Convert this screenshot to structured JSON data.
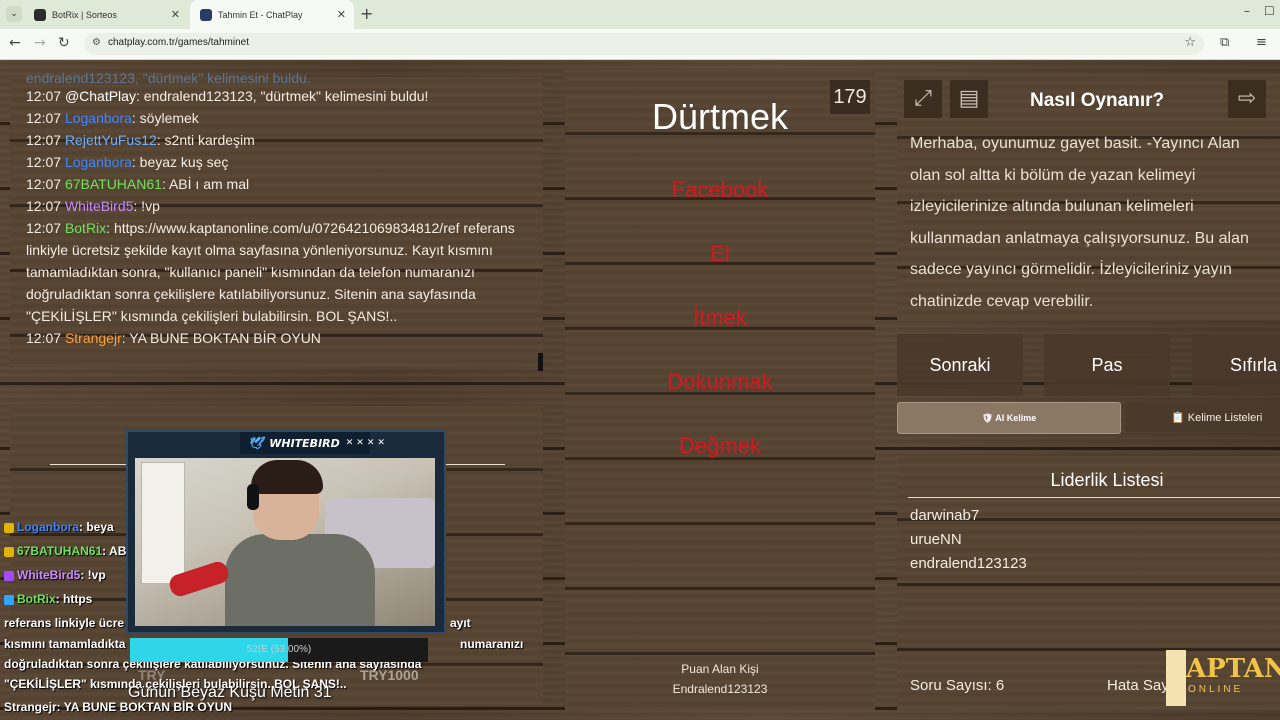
{
  "browser": {
    "tabs": [
      {
        "title": "BotRix | Sorteos",
        "active": false
      },
      {
        "title": "Tahmin Et - ChatPlay",
        "active": true
      }
    ],
    "url": "chatplay.com.tr/games/tahminet"
  },
  "chat": {
    "partial_line": "endralend123123, \"dürtmek\" kelimesini buldu.",
    "lines": [
      {
        "time": "12:07",
        "user": "@ChatPlay",
        "color": "#ffffff",
        "text": ": endralend123123, \"dürtmek\" kelimesini buldu!"
      },
      {
        "time": "12:07",
        "user": "Loganbora",
        "color": "#3e85ff",
        "text": ": söylemek"
      },
      {
        "time": "12:07",
        "user": "RejettYuFus12",
        "color": "#6ab0ff",
        "text": ": s2nti kardeşim"
      },
      {
        "time": "12:07",
        "user": "Loganbora",
        "color": "#3e85ff",
        "text": ": beyaz kuş seç"
      },
      {
        "time": "12:07",
        "user": "67BATUHAN61",
        "color": "#71e05c",
        "text": ": ABİ ı am mal"
      },
      {
        "time": "12:07",
        "user": "WhiteBird5",
        "color": "#c78bff",
        "text": ": !vp"
      },
      {
        "time": "12:07",
        "user": "BotRix",
        "color": "#71e05c",
        "text": ": https://www.kaptanonline.com/u/0726421069834812/ref referans linkiyle ücretsiz şekilde kayıt olma sayfasına yönleniyorsunuz. Kayıt kısmını tamamladıktan sonra, \"kullanıcı paneli\" kısmından da telefon numaranızı doğruladıktan sonra çekilişlere katılabiliyorsunuz. Sitenin ana sayfasında \"ÇEKİLİŞLER\" kısmında çekilişleri bulabilirsin. BOL ŞANS!.."
      },
      {
        "time": "12:07",
        "user": "Strangejr",
        "color": "#ff9f38",
        "text": ": YA BUNE BOKTAN BİR OYUN"
      }
    ]
  },
  "overlay_chat": [
    {
      "user": "Loganbora",
      "color": "#3e85ff",
      "text": ": beya",
      "badge": "#e2b400"
    },
    {
      "user": "67BATUHAN61",
      "color": "#71e05c",
      "text": ": AB",
      "badge": "#e2b400"
    },
    {
      "user": "WhiteBird5",
      "color": "#c78bff",
      "text": ": !vp",
      "badge": "#a24bff"
    },
    {
      "user": "BotRix",
      "color": "#71e05c",
      "text": ": https",
      "badge": "#2fa7ff"
    }
  ],
  "overlay_chat_body": [
    "referans linkiyle ücre",
    "kısmını tamamladıkta",
    "doğruladıktan sonra çekilişlere katılabiliyorsunuz. Sitenin ana sayfasında",
    "\"ÇEKİLİŞLER\" kısmında çekilişleri bulabilirsin. BOL ŞANS!..",
    "Strangejr: YA BUNE BOKTAN BİR OYUN"
  ],
  "overlay_chat_right": [
    "ayıt",
    "numaranızı"
  ],
  "webcam": {
    "title": "WHITEBIRD",
    "progress_text": "52(E (53.00%)",
    "progress": 0.53,
    "try_left": "TRY",
    "try_right": "TRY1000",
    "caption": "Günün Beyaz Kuşu Metin  31"
  },
  "game": {
    "counter": "179",
    "word": "Dürtmek",
    "forbidden": [
      "Facebook",
      "El",
      "İtmek",
      "Dokunmak",
      "Değmek"
    ],
    "forbidden_color": "#d7171f",
    "scorer_label": "Puan Alan Kişi",
    "scorer_name": "Endralend123123"
  },
  "howto": {
    "title": "Nasıl Oynanır?",
    "text": "Merhaba, oyunumuz gayet basit. -Yayıncı Alan\nolan sol altta ki bölüm de yazan kelimeyi\nizleyicilerinize altında bulunan kelimeleri\nkullanmadan anlatmaya çalışıyorsunuz. Bu alan\nsadece yayıncı görmelidir. İzleyicileriniz yayın\nchatinizde cevap verebilir.",
    "icons": [
      "expand-icon",
      "list-icon",
      "exit-icon"
    ]
  },
  "controls": {
    "next": "Sonraki",
    "pass": "Pas",
    "reset": "Sıfırla",
    "ai_word": "🛡 AI Kelime",
    "word_lists": "📋 Kelime Listeleri"
  },
  "leaderboard": {
    "title": "Liderlik Listesi",
    "entries": [
      "darwinab7",
      "urueNN",
      "endralend123123"
    ],
    "question_count_label": "Soru Sayısı: 6",
    "error_count_label": "Hata Sayısı"
  },
  "logo": {
    "text": "APTAN",
    "sub": "ONLINE"
  }
}
